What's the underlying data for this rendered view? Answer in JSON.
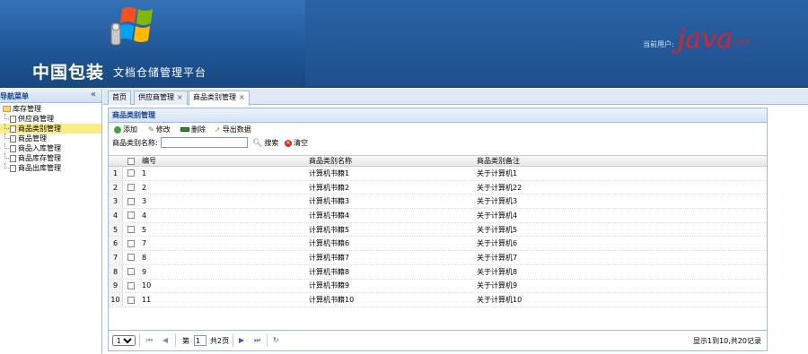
{
  "header": {
    "brand": "中国包装",
    "subtitle": "文档仓储管理平台",
    "user_label": "当前用户:",
    "user_name": "java",
    "user_suffix": "1002"
  },
  "sidebar": {
    "title": "导航菜单",
    "collapse_icon": "«",
    "root": "库存管理",
    "items": [
      {
        "label": "供应商管理"
      },
      {
        "label": "商品类别管理"
      },
      {
        "label": "商品管理"
      },
      {
        "label": "商品入库管理"
      },
      {
        "label": "商品库存管理"
      },
      {
        "label": "商品出库管理"
      }
    ]
  },
  "tabs": [
    {
      "label": "首页"
    },
    {
      "label": "供应商管理"
    },
    {
      "label": "商品类别管理"
    }
  ],
  "tab_close": "×",
  "panel": {
    "title": "商品类别管理",
    "toolbar": {
      "add": "添加",
      "edit": "修改",
      "delete": "删除",
      "export": "导出数据"
    },
    "search": {
      "label": "商品类别名称:",
      "value": "",
      "search_btn": "搜索",
      "clear_btn": "清空"
    },
    "columns": {
      "id": "编号",
      "name": "商品类别名称",
      "remark": "商品类别备注"
    },
    "rows": [
      {
        "n": "1",
        "id": "1",
        "name": "计算机书籍1",
        "remark": "关于计算机1"
      },
      {
        "n": "2",
        "id": "2",
        "name": "计算机书籍2",
        "remark": "关于计算机22"
      },
      {
        "n": "3",
        "id": "3",
        "name": "计算机书籍3",
        "remark": "关于计算机3"
      },
      {
        "n": "4",
        "id": "4",
        "name": "计算机书籍4",
        "remark": "关于计算机4"
      },
      {
        "n": "5",
        "id": "5",
        "name": "计算机书籍5",
        "remark": "关于计算机5"
      },
      {
        "n": "6",
        "id": "7",
        "name": "计算机书籍6",
        "remark": "关于计算机6"
      },
      {
        "n": "7",
        "id": "8",
        "name": "计算机书籍7",
        "remark": "关于计算机7"
      },
      {
        "n": "8",
        "id": "9",
        "name": "计算机书籍8",
        "remark": "关于计算机8"
      },
      {
        "n": "9",
        "id": "10",
        "name": "计算机书籍9",
        "remark": "关于计算机9"
      },
      {
        "n": "10",
        "id": "11",
        "name": "计算机书籍10",
        "remark": "关于计算机10"
      }
    ],
    "pager": {
      "page_size": "10",
      "page_prefix": "第",
      "page_value": "1",
      "page_suffix": "共2页",
      "info": "显示1到10,共20记录"
    }
  },
  "colors": {
    "header_bg": "#1e4f8e",
    "accent": "#15428b",
    "user_name": "#e0202a",
    "selected": "#fbec88"
  }
}
